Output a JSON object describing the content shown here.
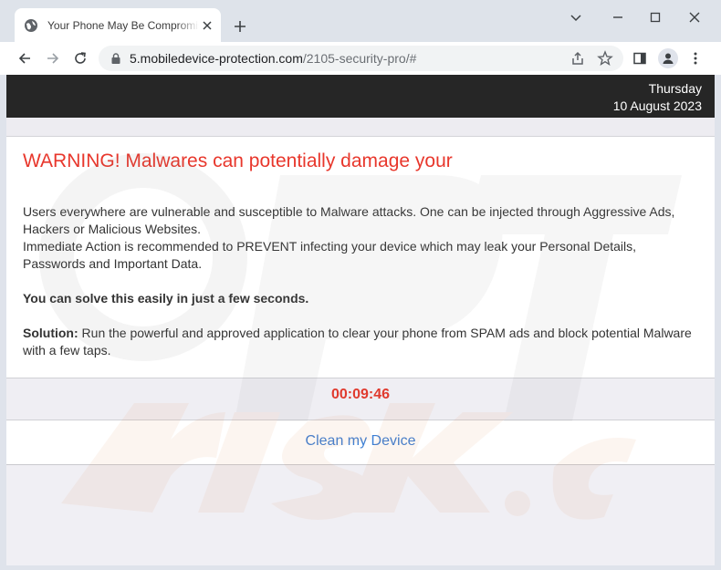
{
  "browser": {
    "tab_title": "Your Phone May Be Compromised",
    "url_domain": "5.mobiledevice-protection.com",
    "url_path": "/2105-security-pro/#"
  },
  "page": {
    "date_day": "Thursday",
    "date_full": "10 August 2023",
    "warning_title": "WARNING! Malwares can potentially damage your",
    "para1": "Users everywhere are vulnerable and susceptible to Malware attacks. One can be injected through Aggressive Ads, Hackers or Malicious Websites.",
    "para2": "Immediate Action is recommended to PREVENT infecting your device which may leak your Personal Details, Passwords and Important Data.",
    "solve_text": "You can solve this easily in just a few seconds.",
    "solution_label": "Solution:",
    "solution_text": " Run the powerful and approved application to clear your phone from SPAM ads and block potential Malware with a few taps.",
    "timer": "00:09:46",
    "clean_button": "Clean my Device"
  },
  "icons": {
    "favicon": "globe-icon",
    "tab_close": "close-icon",
    "new_tab": "plus-icon",
    "minimize": "minimize-icon",
    "maximize": "maximize-icon",
    "close_window": "close-icon",
    "back": "back-arrow-icon",
    "forward": "forward-arrow-icon",
    "reload": "reload-icon",
    "lock": "lock-icon",
    "share": "share-icon",
    "bookmark": "star-icon",
    "side_panel": "side-panel-icon",
    "profile": "profile-icon",
    "menu": "kebab-menu-icon"
  },
  "colors": {
    "warning_red": "#e8372c",
    "timer_red": "#e03a2e",
    "link_blue": "#3d7fd4",
    "date_bar": "#262626"
  }
}
